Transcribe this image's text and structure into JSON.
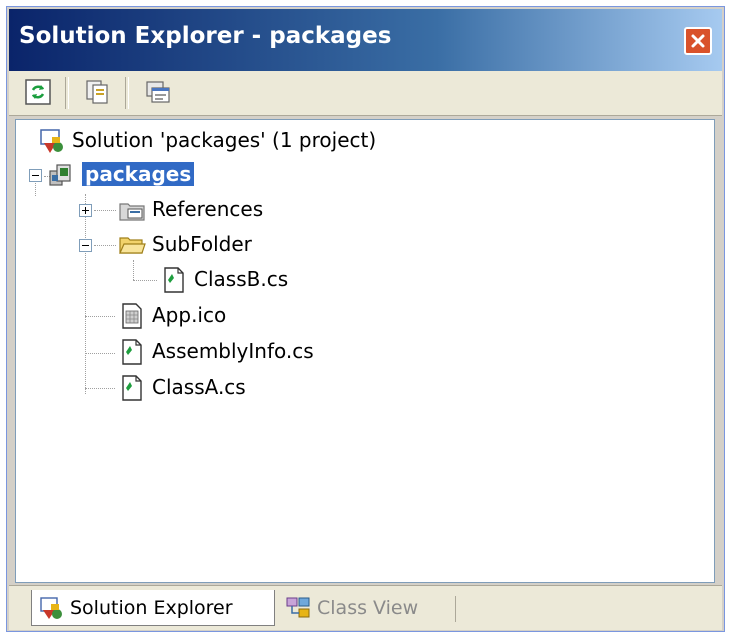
{
  "window": {
    "title": "Solution Explorer - packages"
  },
  "toolbar": {
    "buttons": [
      {
        "icon": "refresh-icon"
      },
      {
        "icon": "show-all-files-icon"
      },
      {
        "icon": "properties-icon"
      }
    ]
  },
  "tree": {
    "nodes": [
      {
        "label": "Solution 'packages' (1 project)",
        "icon": "solution-icon"
      },
      {
        "label": "packages",
        "icon": "csharp-project-icon",
        "selected": true,
        "expanded": true
      },
      {
        "label": "References",
        "icon": "references-folder-icon",
        "expanded": false
      },
      {
        "label": "SubFolder",
        "icon": "folder-open-icon",
        "expanded": true
      },
      {
        "label": "ClassB.cs",
        "icon": "csharp-file-icon"
      },
      {
        "label": "App.ico",
        "icon": "icon-file-icon"
      },
      {
        "label": "AssemblyInfo.cs",
        "icon": "csharp-file-icon"
      },
      {
        "label": "ClassA.cs",
        "icon": "csharp-file-icon"
      }
    ]
  },
  "tabs": [
    {
      "label": "Solution Explorer",
      "icon": "solution-explorer-icon",
      "active": true
    },
    {
      "label": "Class View",
      "icon": "class-view-icon",
      "active": false
    }
  ],
  "colors": {
    "selection": "#316ac5",
    "title_gradient_start": "#0a246a",
    "close_button": "#d9522b"
  }
}
